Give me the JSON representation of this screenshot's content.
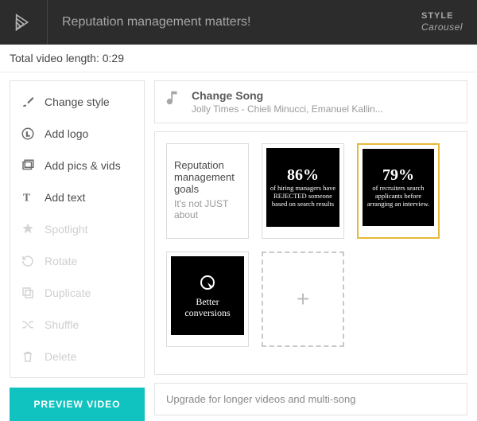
{
  "header": {
    "title": "Reputation management matters!",
    "style_label": "STYLE",
    "style_value": "Carousel"
  },
  "subbar": {
    "length_label": "Total video length: 0:29"
  },
  "sidebar": {
    "actions": [
      {
        "icon": "brush",
        "label": "Change style",
        "enabled": true
      },
      {
        "icon": "logo-badge",
        "label": "Add logo",
        "enabled": true
      },
      {
        "icon": "pics",
        "label": "Add pics & vids",
        "enabled": true
      },
      {
        "icon": "text",
        "label": "Add text",
        "enabled": true
      },
      {
        "icon": "star",
        "label": "Spotlight",
        "enabled": false
      },
      {
        "icon": "rotate",
        "label": "Rotate",
        "enabled": false
      },
      {
        "icon": "duplicate",
        "label": "Duplicate",
        "enabled": false
      },
      {
        "icon": "shuffle",
        "label": "Shuffle",
        "enabled": false
      },
      {
        "icon": "trash",
        "label": "Delete",
        "enabled": false
      }
    ],
    "preview_label": "PREVIEW VIDEO"
  },
  "song": {
    "title": "Change Song",
    "subtitle": "Jolly Times - Chieli Minucci, Emanuel Kallin..."
  },
  "slides": [
    {
      "kind": "text",
      "line1": "Reputation management goals",
      "line2": "It's not JUST about",
      "selected": false
    },
    {
      "kind": "stat",
      "stat": "86%",
      "caption": "of hiring managers have REJECTED someone based on search results",
      "selected": false
    },
    {
      "kind": "stat",
      "stat": "79%",
      "caption": "of recruiters search applicants before arranging an interview.",
      "selected": true
    },
    {
      "kind": "graphic",
      "line1": "Better",
      "line2": "conversions",
      "selected": false
    }
  ],
  "upgrade": {
    "label": "Upgrade for longer videos and multi-song"
  }
}
